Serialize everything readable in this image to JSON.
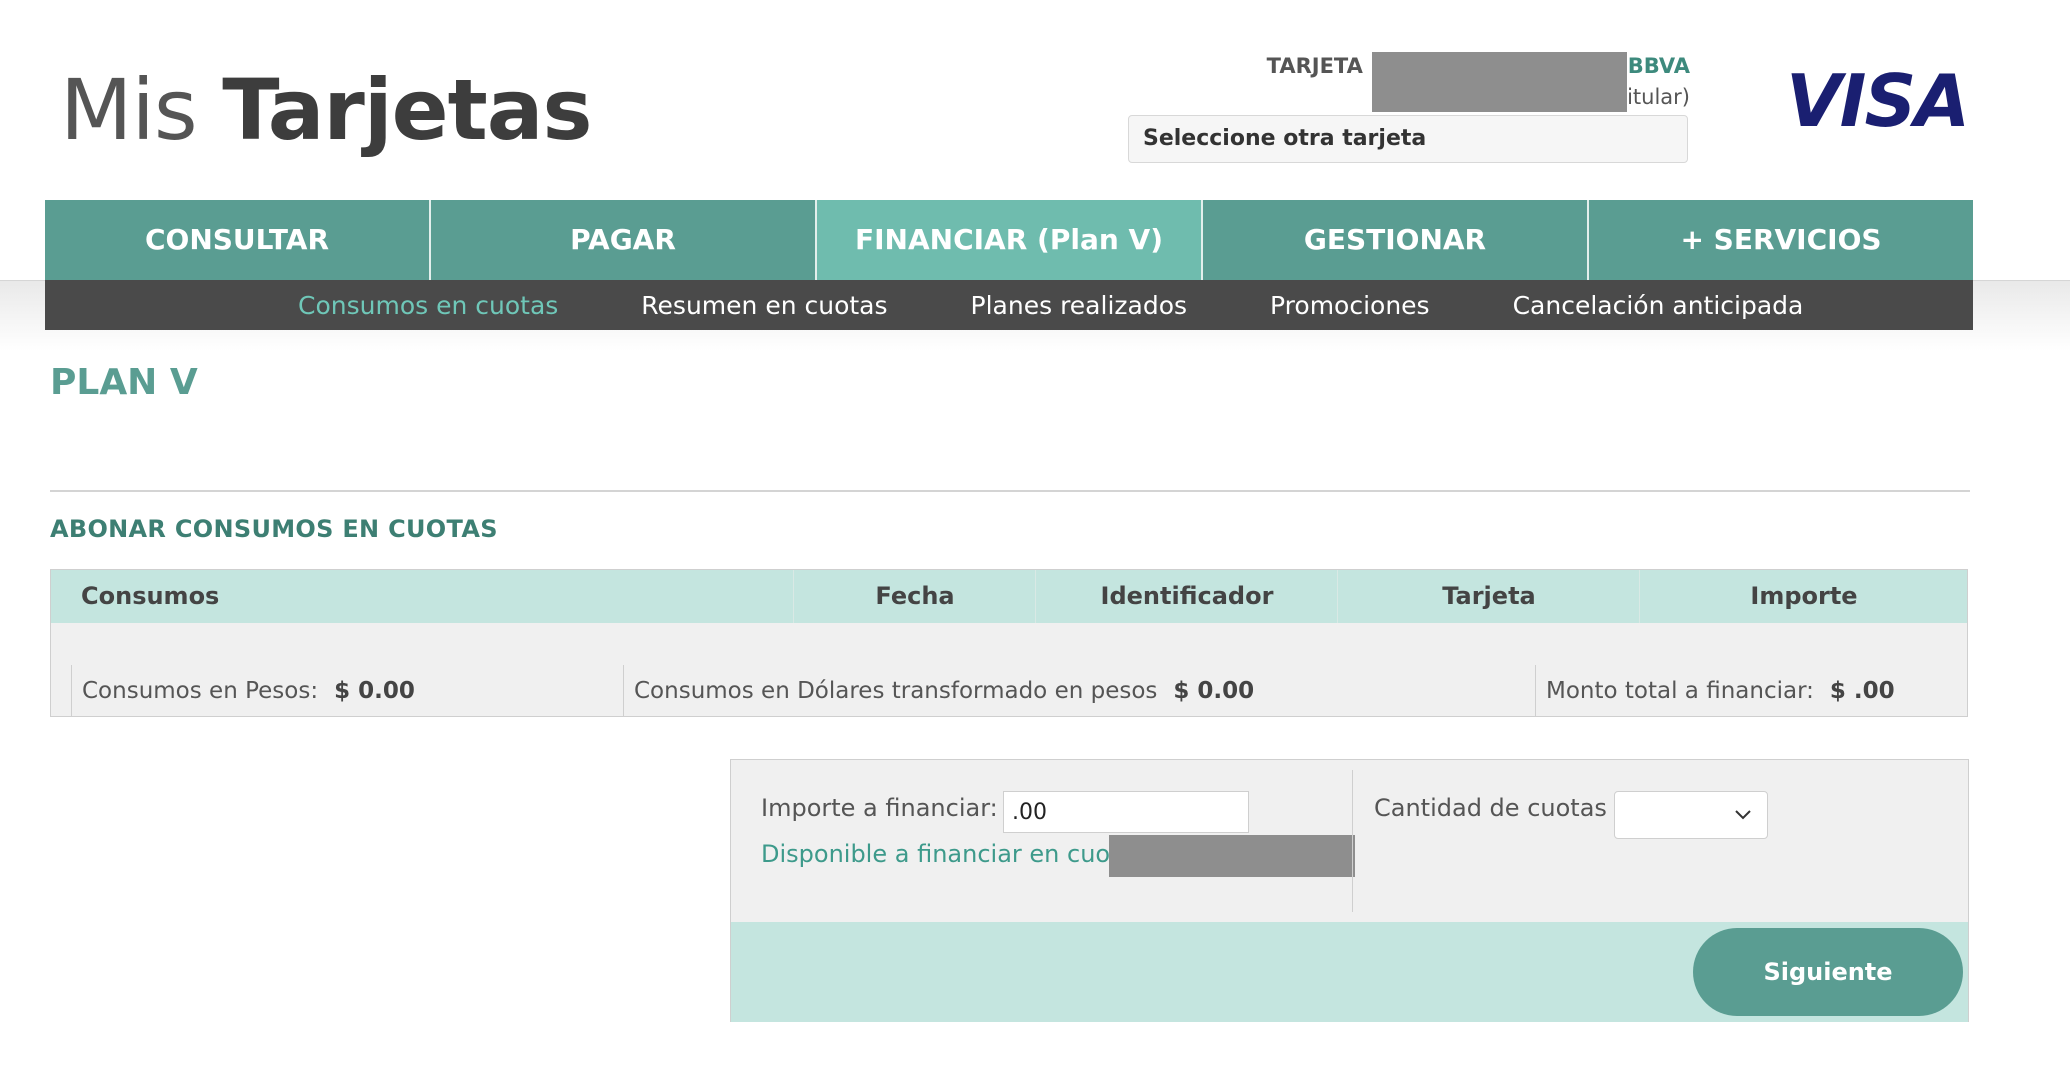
{
  "header": {
    "logo_light": "Mis ",
    "logo_bold": "Tarjetas",
    "card_label": "TARJETA Nº:",
    "card_bank": "BBVA",
    "card_holder": "itular)",
    "card_select_label": "Seleccione otra tarjeta",
    "brand_logo": "VISA"
  },
  "main_nav": {
    "items": [
      {
        "label": "CONSULTAR"
      },
      {
        "label": "PAGAR"
      },
      {
        "label": "FINANCIAR (Plan V)"
      },
      {
        "label": "GESTIONAR"
      },
      {
        "label": "+ SERVICIOS"
      }
    ],
    "active": "FINANCIAR (Plan V)"
  },
  "sub_nav": {
    "items": [
      {
        "label": "Consumos en cuotas"
      },
      {
        "label": "Resumen en cuotas"
      },
      {
        "label": "Planes realizados"
      },
      {
        "label": "Promociones"
      },
      {
        "label": "Cancelación anticipada"
      }
    ],
    "active": "Consumos en cuotas"
  },
  "page": {
    "title": "PLAN V",
    "section_title": "ABONAR CONSUMOS EN CUOTAS"
  },
  "table": {
    "columns": [
      "Consumos",
      "Fecha",
      "Identificador",
      "Tarjeta",
      "Importe"
    ],
    "totals": {
      "pesos_label": "Consumos en Pesos:",
      "pesos_value": "$ 0.00",
      "dolares_label": "Consumos en Dólares transformado en pesos",
      "dolares_value": "$ 0.00",
      "total_label": "Monto total a financiar:",
      "total_value": "$ .00"
    }
  },
  "form": {
    "importe_label": "Importe a financiar: $",
    "importe_value": ".00",
    "disponible_label": "Disponible a financiar en cuotas:",
    "cuotas_label": "Cantidad de cuotas",
    "cuotas_value": "",
    "next_button": "Siguiente"
  },
  "colors": {
    "teal": "#5a9d92",
    "teal_active": "#6fbcae",
    "teal_light": "#c4e5df",
    "dark_nav": "#4a4a4a",
    "visa_blue": "#1a1f71"
  }
}
